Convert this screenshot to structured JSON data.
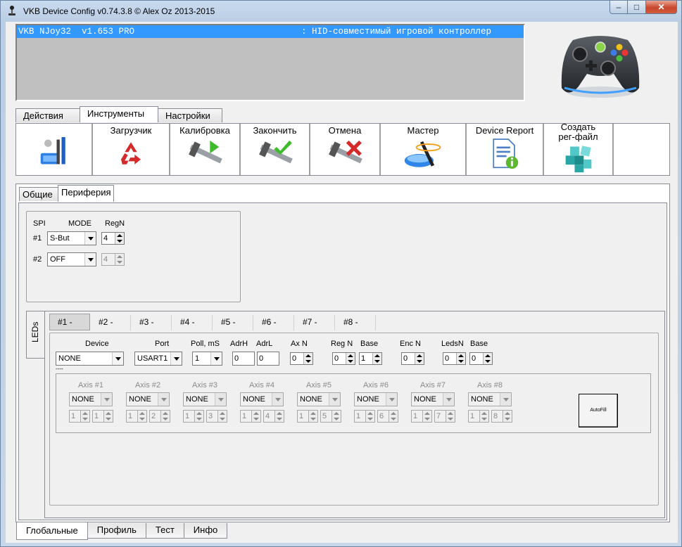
{
  "window": {
    "title": "VKB Device Config v0.74.3.8 © Alex Oz 2013-2015",
    "min_glyph": "–",
    "max_glyph": "□",
    "close_glyph": "✕"
  },
  "device_list": {
    "selected": {
      "name": "VKB NJoy32  v1.653 PRO",
      "description": ": HID-совместимый игровой контроллер"
    }
  },
  "main_tabs": [
    {
      "label": "Действия",
      "active": false
    },
    {
      "label": "Инструменты",
      "active": true
    },
    {
      "label": "Настройки",
      "active": false
    }
  ],
  "toolbar": [
    {
      "label": "",
      "icon": "usb-tools-icon"
    },
    {
      "label": "Загрузчик",
      "icon": "recycle-icon"
    },
    {
      "label": "Калибровка",
      "icon": "caliper-play-icon"
    },
    {
      "label": "Закончить",
      "icon": "caliper-check-icon"
    },
    {
      "label": "Отмена",
      "icon": "caliper-cross-icon"
    },
    {
      "label": "Мастер",
      "icon": "magic-wand-icon"
    },
    {
      "label": "Device Report",
      "icon": "report-info-icon"
    },
    {
      "label": "Создать\nрег-файл",
      "icon": "registry-cubes-icon"
    }
  ],
  "sub_tabs": [
    {
      "label": "Общие",
      "active": false
    },
    {
      "label": "Периферия",
      "active": true
    }
  ],
  "spi": {
    "headers": {
      "spi": "SPI",
      "mode": "MODE",
      "regn": "RegN"
    },
    "rows": [
      {
        "label": "#1",
        "mode": "S-But",
        "regn": "4",
        "enabled": true
      },
      {
        "label": "#2",
        "mode": "OFF",
        "regn": "4",
        "enabled": false
      }
    ]
  },
  "leds": {
    "side_tab": "LEDs",
    "tabs": [
      "#1 -",
      "#2 -",
      "#3 -",
      "#4 -",
      "#5 -",
      "#6 -",
      "#7 -",
      "#8 -"
    ],
    "active_tab": 0,
    "headers": {
      "device": "Device",
      "port": "Port",
      "poll": "Poll, mS",
      "adrh": "AdrH",
      "adrl": "AdrL",
      "axn": "Ax N",
      "regn": "Reg N",
      "base1": "Base",
      "encn": "Enc N",
      "ledsn": "LedsN",
      "base2": "Base"
    },
    "values": {
      "device": "NONE",
      "port": "USART1",
      "poll": "1",
      "adrh": "0",
      "adrl": "0",
      "axn": "0",
      "regn": "0",
      "base1": "1",
      "encn": "0",
      "ledsn": "0",
      "base2": "0"
    },
    "dash": "----",
    "axes": [
      {
        "label": "Axis #1",
        "value": "NONE",
        "a": "1",
        "b": "1"
      },
      {
        "label": "Axis #2",
        "value": "NONE",
        "a": "1",
        "b": "2"
      },
      {
        "label": "Axis #3",
        "value": "NONE",
        "a": "1",
        "b": "3"
      },
      {
        "label": "Axis #4",
        "value": "NONE",
        "a": "1",
        "b": "4"
      },
      {
        "label": "Axis #5",
        "value": "NONE",
        "a": "1",
        "b": "5"
      },
      {
        "label": "Axis #6",
        "value": "NONE",
        "a": "1",
        "b": "6"
      },
      {
        "label": "Axis #7",
        "value": "NONE",
        "a": "1",
        "b": "7"
      },
      {
        "label": "Axis #8",
        "value": "NONE",
        "a": "1",
        "b": "8"
      }
    ],
    "autofill_label": "AutoFill"
  },
  "bottom_tabs": [
    {
      "label": "Глобальные",
      "active": true
    },
    {
      "label": "Профиль",
      "active": false
    },
    {
      "label": "Тест",
      "active": false
    },
    {
      "label": "Инфо",
      "active": false
    }
  ]
}
